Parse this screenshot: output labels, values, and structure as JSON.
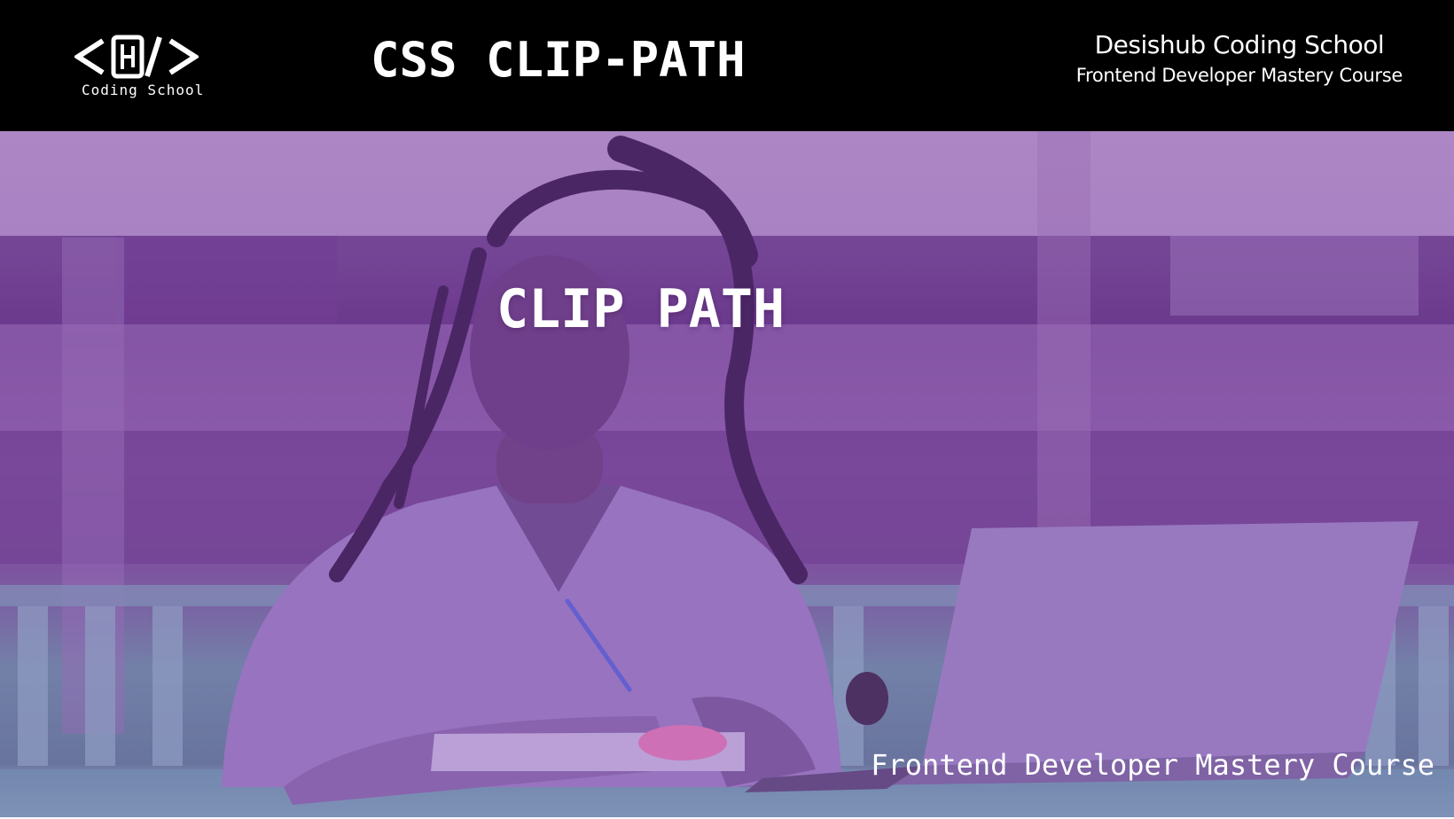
{
  "header": {
    "logo_icon": "code-bracket-logo",
    "logo_subtitle": "Coding School",
    "title": "CSS CLIP-PATH",
    "brand_name": "Desishub Coding School",
    "brand_course": "Frontend Developer Mastery Course"
  },
  "hero": {
    "title": "CLIP PATH",
    "course": "Frontend Developer Mastery Course",
    "overlay_color": "#8a4fb0",
    "image_subject": "student-writing-at-laptop"
  }
}
